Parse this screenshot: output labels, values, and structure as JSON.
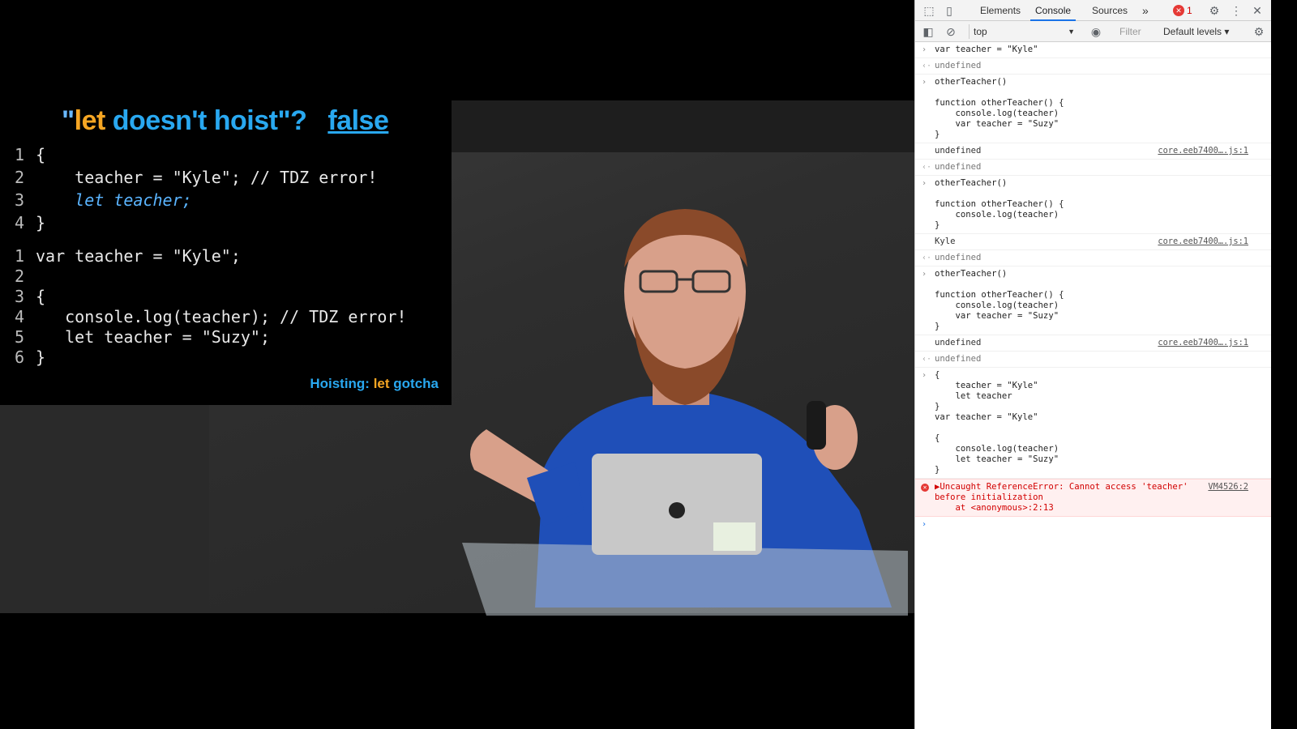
{
  "slide": {
    "title_quote_open": "\"",
    "title_let": "let",
    "title_rest": "doesn't hoist\"?",
    "title_answer": "false",
    "code1": [
      {
        "ln": "1",
        "text": "{"
      },
      {
        "ln": "2",
        "text": "    teacher = \"Kyle\"; // TDZ error!"
      },
      {
        "ln": "3",
        "text": "    let teacher;"
      },
      {
        "ln": "4",
        "text": "}"
      }
    ],
    "code2": [
      {
        "ln": "1",
        "text": "var teacher = \"Kyle\";"
      },
      {
        "ln": "2",
        "text": ""
      },
      {
        "ln": "3",
        "text": "{"
      },
      {
        "ln": "4",
        "text": "   console.log(teacher); // TDZ error!"
      },
      {
        "ln": "5",
        "text": "   let teacher = \"Suzy\";"
      },
      {
        "ln": "6",
        "text": "}"
      }
    ],
    "footer_a": "Hoisting: ",
    "footer_let": "let",
    "footer_b": " gotcha"
  },
  "devtools": {
    "tabs": [
      "Elements",
      "Console",
      "Sources"
    ],
    "active_tab": "Console",
    "more_tabs": "»",
    "error_count": "1",
    "context": "top",
    "filter_placeholder": "Filter",
    "levels": "Default levels",
    "console": [
      {
        "type": "input",
        "text": "var teacher = \"Kyle\""
      },
      {
        "type": "result",
        "text": "undefined"
      },
      {
        "type": "input",
        "text": "otherTeacher()\n\nfunction otherTeacher() {\n    console.log(teacher)\n    var teacher = \"Suzy\"\n}"
      },
      {
        "type": "log",
        "text": "undefined",
        "src": "core.eeb7400….js:1"
      },
      {
        "type": "result",
        "text": "undefined"
      },
      {
        "type": "input",
        "text": "otherTeacher()\n\nfunction otherTeacher() {\n    console.log(teacher)\n}"
      },
      {
        "type": "log",
        "text": "Kyle",
        "src": "core.eeb7400….js:1"
      },
      {
        "type": "result",
        "text": "undefined"
      },
      {
        "type": "input",
        "text": "otherTeacher()\n\nfunction otherTeacher() {\n    console.log(teacher)\n    var teacher = \"Suzy\"\n}"
      },
      {
        "type": "log",
        "text": "undefined",
        "src": "core.eeb7400….js:1"
      },
      {
        "type": "result",
        "text": "undefined"
      },
      {
        "type": "input",
        "text": "{\n    teacher = \"Kyle\"\n    let teacher\n}\nvar teacher = \"Kyle\"\n\n{\n    console.log(teacher)\n    let teacher = \"Suzy\"\n}"
      },
      {
        "type": "error",
        "text": "▶Uncaught ReferenceError: Cannot access 'teacher'\nbefore initialization\n    at <anonymous>:2:13",
        "src": "VM4526:2"
      },
      {
        "type": "prompt",
        "text": ""
      }
    ],
    "colors": {
      "accent": "#1a73e8",
      "error": "#d20000"
    }
  }
}
